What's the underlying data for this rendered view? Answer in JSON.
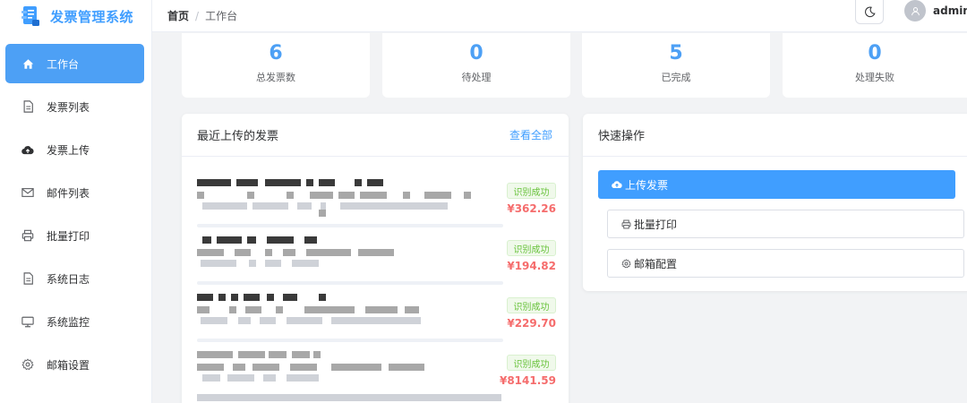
{
  "brand": {
    "title": "发票管理系统",
    "logo_icon": "invoice-logo-icon"
  },
  "breadcrumb": {
    "home": "首页",
    "separator": "/",
    "current": "工作台"
  },
  "header": {
    "theme_icon": "moon-icon",
    "username": "admin"
  },
  "sidebar": {
    "items": [
      {
        "label": "工作台",
        "icon": "home-icon",
        "active": true
      },
      {
        "label": "发票列表",
        "icon": "document-icon"
      },
      {
        "label": "发票上传",
        "icon": "cloud-upload-icon"
      },
      {
        "label": "邮件列表",
        "icon": "mail-icon"
      },
      {
        "label": "批量打印",
        "icon": "printer-icon"
      },
      {
        "label": "系统日志",
        "icon": "document-icon"
      },
      {
        "label": "系统监控",
        "icon": "monitor-icon"
      },
      {
        "label": "邮箱设置",
        "icon": "gear-icon"
      }
    ]
  },
  "stats": [
    {
      "value": "6",
      "label": "总发票数"
    },
    {
      "value": "0",
      "label": "待处理"
    },
    {
      "value": "5",
      "label": "已完成"
    },
    {
      "value": "0",
      "label": "处理失败"
    }
  ],
  "recent": {
    "title": "最近上传的发票",
    "view_all": "查看全部",
    "items": [
      {
        "status": "识别成功",
        "amount": "¥362.26"
      },
      {
        "status": "识别成功",
        "amount": "¥194.82"
      },
      {
        "status": "识别成功",
        "amount": "¥229.70"
      },
      {
        "status": "识别成功",
        "amount": "¥8141.59"
      }
    ]
  },
  "quick_actions": {
    "title": "快速操作",
    "upload": "上传发票",
    "print": "批量打印",
    "mail_config": "邮箱配置"
  },
  "colors": {
    "primary": "#409eff",
    "success": "#67c23a",
    "danger": "#f56c6c"
  }
}
